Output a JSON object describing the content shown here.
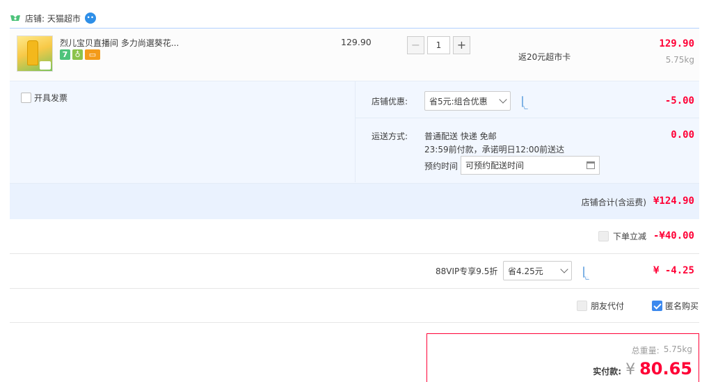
{
  "shop": {
    "label": "店铺: 天猫超市"
  },
  "item": {
    "title": "烈儿宝贝直播间 多力尚選葵花...",
    "badge_1": "7",
    "unit_price": "129.90",
    "quantity": "1",
    "qty_minus": "−",
    "qty_plus": "+",
    "promo": "返20元超市卡",
    "subtotal": "129.90",
    "weight": "5.75kg"
  },
  "invoice": {
    "label": "开具发票",
    "checked": false
  },
  "shop_discount": {
    "label": "店铺优惠:",
    "selected": "省5元:组合优惠",
    "amount": "-5.00"
  },
  "shipping": {
    "label": "运送方式:",
    "method": "普通配送 快递 免邮",
    "promise": "23:59前付款，承诺明日12:00前送达",
    "appointment_label": "预约时间",
    "appointment_placeholder": "可预约配送时间",
    "fee": "0.00"
  },
  "shop_total": {
    "label": "店铺合计(含运费)",
    "amount": "¥124.90"
  },
  "instant_discount": {
    "label": "下单立减",
    "amount": "-¥40.00",
    "checked": true
  },
  "vip": {
    "label": "88VIP专享9.5折",
    "selected": "省4.25元",
    "amount": "¥ -4.25"
  },
  "options": {
    "friend_pay": "朋友代付",
    "anonymous": "匿名购买",
    "anonymous_checked": true
  },
  "final": {
    "weight_label": "总重量:",
    "weight": "5.75kg",
    "pay_label": "实付款:",
    "currency": "¥",
    "amount": "80.65"
  },
  "colors": {
    "accent_red": "#ff0036",
    "border_blue": "#b2d1ff",
    "panel_bg": "#f2f7ff",
    "checkbox_blue": "#3c89ee"
  }
}
